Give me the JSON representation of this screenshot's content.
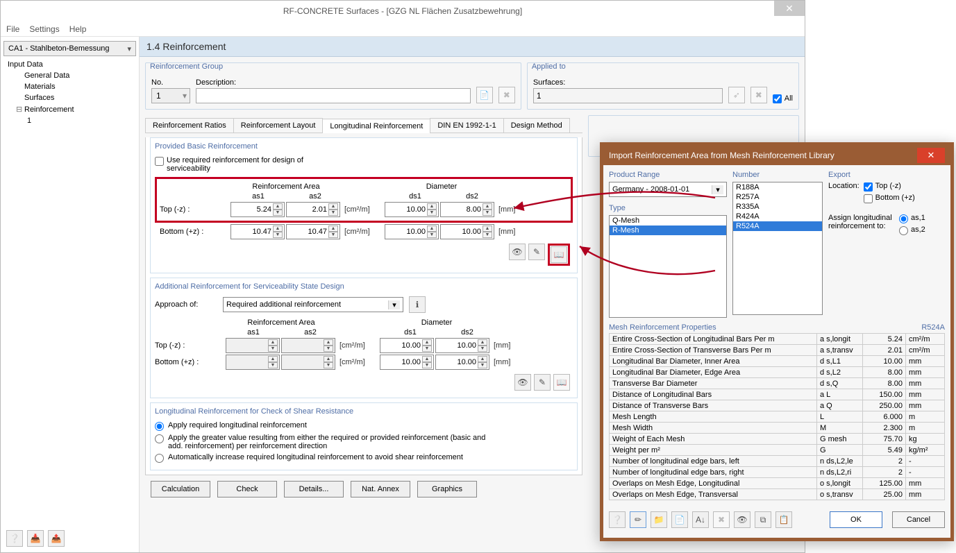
{
  "window": {
    "title": "RF-CONCRETE Surfaces - [GZG NL Flächen Zusatzbewehrung]"
  },
  "menu": {
    "file": "File",
    "settings": "Settings",
    "help": "Help"
  },
  "case_combo": "CA1 - Stahlbeton-Bemessung",
  "tree": {
    "root": "Input Data",
    "n1": "General Data",
    "n2": "Materials",
    "n3": "Surfaces",
    "n4": "Reinforcement",
    "n4c": "1"
  },
  "section_title": "1.4 Reinforcement",
  "reinf_group": {
    "legend": "Reinforcement Group",
    "no_label": "No.",
    "desc_label": "Description:",
    "no_value": "1",
    "desc_value": ""
  },
  "applied_to": {
    "legend": "Applied to",
    "surfaces_label": "Surfaces:",
    "surfaces_value": "1",
    "all_label": "All"
  },
  "tabs": {
    "t1": "Reinforcement Ratios",
    "t2": "Reinforcement Layout",
    "t3": "Longitudinal Reinforcement",
    "t4": "DIN EN 1992-1-1",
    "t5": "Design Method"
  },
  "basic": {
    "legend": "Provided Basic Reinforcement",
    "use_req": "Use required reinforcement for design of serviceability",
    "area_header": "Reinforcement Area",
    "diam_header": "Diameter",
    "as1": "as1",
    "as2": "as2",
    "ds1": "ds1",
    "ds2": "ds2",
    "top_label": "Top (-z) :",
    "bottom_label": "Bottom (+z) :",
    "top_as1": "5.24",
    "top_as2": "2.01",
    "top_ds1": "10.00",
    "top_ds2": "8.00",
    "bot_as1": "10.47",
    "bot_as2": "10.47",
    "bot_ds1": "10.00",
    "bot_ds2": "10.00",
    "unit_area": "[cm²/m]",
    "unit_mm": "[mm]"
  },
  "additional": {
    "legend": "Additional Reinforcement for Serviceability State Design",
    "approach_label": "Approach of:",
    "approach_value": "Required additional reinforcement",
    "top_ds1": "10.00",
    "top_ds2": "10.00",
    "bot_ds1": "10.00",
    "bot_ds2": "10.00"
  },
  "shear": {
    "legend": "Longitudinal Reinforcement for Check of Shear Resistance",
    "r1": "Apply required longitudinal reinforcement",
    "r2": "Apply the greater value resulting from either the required or provided reinforcement (basic and add. reinforcement) per reinforcement direction",
    "r3": "Automatically increase required longitudinal reinforcement to avoid shear reinforcement"
  },
  "buttons": {
    "calculation": "Calculation",
    "check": "Check",
    "details": "Details...",
    "nat_annex": "Nat. Annex",
    "graphics": "Graphics"
  },
  "dialog": {
    "title": "Import Reinforcement Area from Mesh Reinforcement Library",
    "product_range_label": "Product Range",
    "product_range_value": "Germany - 2008-01-01",
    "type_label": "Type",
    "types": [
      "Q-Mesh",
      "R-Mesh"
    ],
    "number_label": "Number",
    "numbers": [
      "R188A",
      "R257A",
      "R335A",
      "R424A",
      "R524A"
    ],
    "export_label": "Export",
    "location_label": "Location:",
    "loc_top": "Top (-z)",
    "loc_bottom": "Bottom (+z)",
    "assign_label": "Assign longitudinal reinforcement to:",
    "as1": "as,1",
    "as2": "as,2",
    "props_title": "Mesh Reinforcement Properties",
    "props_tag": "R524A",
    "rows": [
      {
        "d": "Entire Cross-Section of Longitudinal Bars Per m",
        "s": "a s,longit",
        "v": "5.24",
        "u": "cm²/m"
      },
      {
        "d": "Entire Cross-Section of Transverse Bars Per m",
        "s": "a s,transv",
        "v": "2.01",
        "u": "cm²/m"
      },
      {
        "d": "Longitudinal Bar Diameter, Inner Area",
        "s": "d s,L1",
        "v": "10.00",
        "u": "mm"
      },
      {
        "d": "Longitudinal Bar Diameter, Edge Area",
        "s": "d s,L2",
        "v": "8.00",
        "u": "mm"
      },
      {
        "d": "Transverse Bar Diameter",
        "s": "d s,Q",
        "v": "8.00",
        "u": "mm"
      },
      {
        "d": "Distance of Longitudinal Bars",
        "s": "a L",
        "v": "150.00",
        "u": "mm"
      },
      {
        "d": "Distance of Transverse Bars",
        "s": "a Q",
        "v": "250.00",
        "u": "mm"
      },
      {
        "d": "Mesh Length",
        "s": "L",
        "v": "6.000",
        "u": "m"
      },
      {
        "d": "Mesh Width",
        "s": "M",
        "v": "2.300",
        "u": "m"
      },
      {
        "d": "Weight of Each Mesh",
        "s": "G mesh",
        "v": "75.70",
        "u": "kg"
      },
      {
        "d": "Weight per m²",
        "s": "G",
        "v": "5.49",
        "u": "kg/m²"
      },
      {
        "d": "Number of longitudinal edge bars, left",
        "s": "n ds,L2,le",
        "v": "2",
        "u": "-"
      },
      {
        "d": "Number of longitudinal edge bars, right",
        "s": "n ds,L2,ri",
        "v": "2",
        "u": "-"
      },
      {
        "d": "Overlaps on Mesh Edge, Longitudinal",
        "s": "o s,longit",
        "v": "125.00",
        "u": "mm"
      },
      {
        "d": "Overlaps on Mesh Edge, Transversal",
        "s": "o s,transv",
        "v": "25.00",
        "u": "mm"
      }
    ],
    "ok": "OK",
    "cancel": "Cancel"
  }
}
